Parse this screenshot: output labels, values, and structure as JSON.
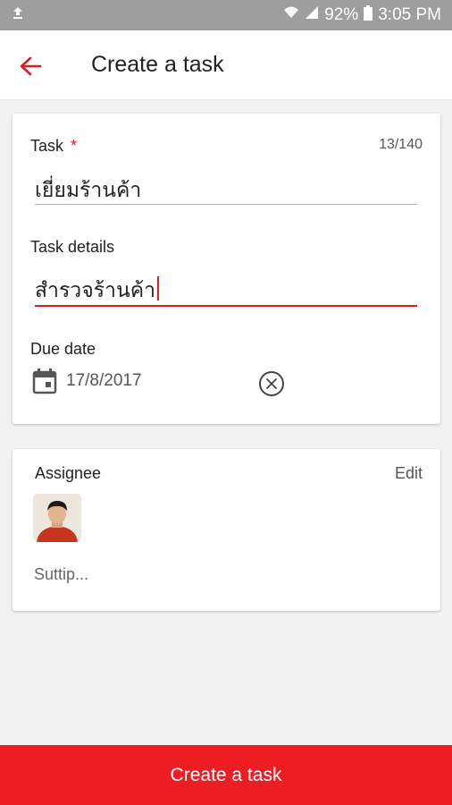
{
  "status_bar": {
    "battery": "92%",
    "time": "3:05 PM",
    "icons": [
      "upload-icon",
      "wifi-icon",
      "signal-icon",
      "battery-icon"
    ]
  },
  "app_bar": {
    "title": "Create a task",
    "back_icon": "arrow-left-icon"
  },
  "task_card": {
    "task_label": "Task",
    "required_marker": "*",
    "counter": "13/140",
    "task_value": "เยี่ยมร้านค้า",
    "details_label": "Task details",
    "details_value": "สำรวจร้านค้า",
    "due_label": "Due date",
    "due_value": "17/8/2017"
  },
  "assignee_card": {
    "label": "Assignee",
    "edit_label": "Edit",
    "name": "Suttip..."
  },
  "footer": {
    "create_label": "Create a task"
  },
  "colors": {
    "accent": "#ee1d24",
    "status_bar": "#9e9e9e",
    "background": "#f2f2f2"
  }
}
